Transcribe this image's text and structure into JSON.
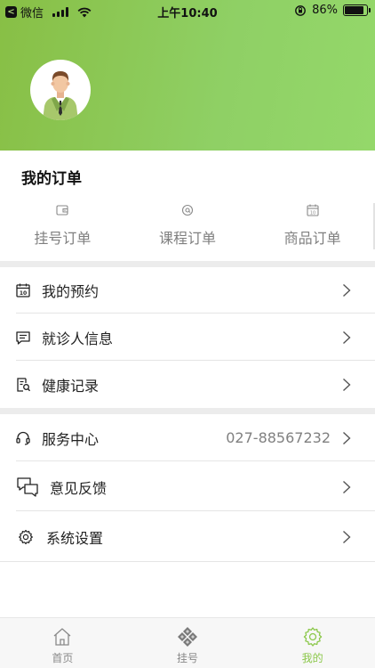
{
  "status_bar": {
    "back_app": "微信",
    "time": "上午10:40",
    "battery": "86%",
    "battery_level": 0.86
  },
  "orders": {
    "title": "我的订单",
    "items": [
      {
        "label": "挂号订单",
        "icon": "wallet-icon"
      },
      {
        "label": "课程订单",
        "icon": "course-icon"
      },
      {
        "label": "商品订单",
        "icon": "calendar-icon"
      }
    ]
  },
  "menu": {
    "appointments": {
      "label": "我的预约",
      "icon": "calendar-icon"
    },
    "patient_info": {
      "label": "就诊人信息",
      "icon": "message-icon"
    },
    "health_records": {
      "label": "健康记录",
      "icon": "document-search-icon"
    },
    "service_center": {
      "label": "服务中心",
      "value": "027-88567232",
      "icon": "headset-icon"
    },
    "feedback": {
      "label": "意见反馈",
      "icon": "chat-bubbles-icon"
    },
    "settings": {
      "label": "系统设置",
      "icon": "gear-icon"
    }
  },
  "tabbar": {
    "items": [
      {
        "label": "首页",
        "icon": "home-icon",
        "active": false
      },
      {
        "label": "挂号",
        "icon": "register-icon",
        "active": false
      },
      {
        "label": "我的",
        "icon": "gear-icon",
        "active": true
      }
    ]
  },
  "colors": {
    "accent": "#8cc84b",
    "header_start": "#88bf45",
    "header_end": "#94d86a",
    "muted_text": "#808080"
  }
}
